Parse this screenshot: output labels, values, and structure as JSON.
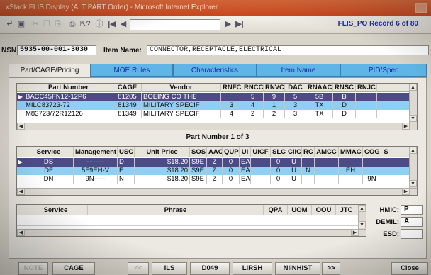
{
  "window": {
    "title": "xStack FLIS Display (ALT PART Order) - Microsoft Internet Explorer"
  },
  "toolbar": {
    "record": "FLIS_PO Record 6 of 80"
  },
  "nsn": {
    "label": "NSN:",
    "value": "5935-00-001-3030",
    "item_name_label": "Item Name:",
    "item_name": "CONNECTOR,RECEPTACLE,ELECTRICAL"
  },
  "tabs": [
    "Part/CAGE/Pricing",
    "MOE Rules",
    "Characteristics",
    "Item Name",
    "PID/Spec"
  ],
  "parts": {
    "columns": [
      "Part Number",
      "CAGE",
      "Vendor",
      "RNFC",
      "RNCC",
      "RNVC",
      "DAC",
      "RNAAC",
      "RNSC",
      "RNJC"
    ],
    "rows": [
      [
        "BACC45FN12-12P6",
        "81205",
        "BOEING CO THE",
        "",
        "5",
        "9",
        "5",
        "5B",
        "B",
        ""
      ],
      [
        "MILC83723-72",
        "81349",
        "MILITARY SPECIF",
        "3",
        "4",
        "1",
        "3",
        "TX",
        "D",
        ""
      ],
      [
        "M83723/72R12126",
        "81349",
        "MILITARY SPECIF",
        "4",
        "2",
        "2",
        "3",
        "TX",
        "D",
        ""
      ]
    ],
    "caption": "Part Number 1 of 3"
  },
  "mgmt": {
    "columns": [
      "Service",
      "Management",
      "USC",
      "Unit Price",
      "SOS",
      "AAC",
      "QUP",
      "UI",
      "UICF",
      "SLC",
      "CIIC",
      "RC",
      "AMCC",
      "MMAC",
      "COG",
      "S"
    ],
    "rows": [
      [
        "DS",
        "--------",
        "D",
        "$18.20",
        "S9E",
        "Z",
        "0",
        "EA",
        "",
        "0",
        "U",
        "",
        "",
        "",
        "",
        ""
      ],
      [
        "DF",
        "5F9EH-V",
        "F",
        "$18.20",
        "S9E",
        "Z",
        "0",
        "EA",
        "",
        "0",
        "U",
        "N",
        "",
        "EH",
        "",
        ""
      ],
      [
        "DN",
        "9N-----",
        "N",
        "$18.20",
        "S9E",
        "Z",
        "0",
        "EA",
        "",
        "0",
        "U",
        "",
        "",
        "",
        "9N",
        ""
      ]
    ]
  },
  "phrase": {
    "columns": [
      "Service",
      "Phrase",
      "QPA",
      "UOM",
      "OOU",
      "JTC"
    ]
  },
  "right_fields": [
    {
      "label": "HMIC:",
      "value": "P"
    },
    {
      "label": "DEMIL:",
      "value": "A"
    },
    {
      "label": "ESD:",
      "value": ""
    }
  ],
  "buttons": [
    "NOTE",
    "CAGE",
    "<<",
    "ILS",
    "D049",
    "LIRSH",
    "NIINHIST",
    ">>",
    "Close"
  ]
}
